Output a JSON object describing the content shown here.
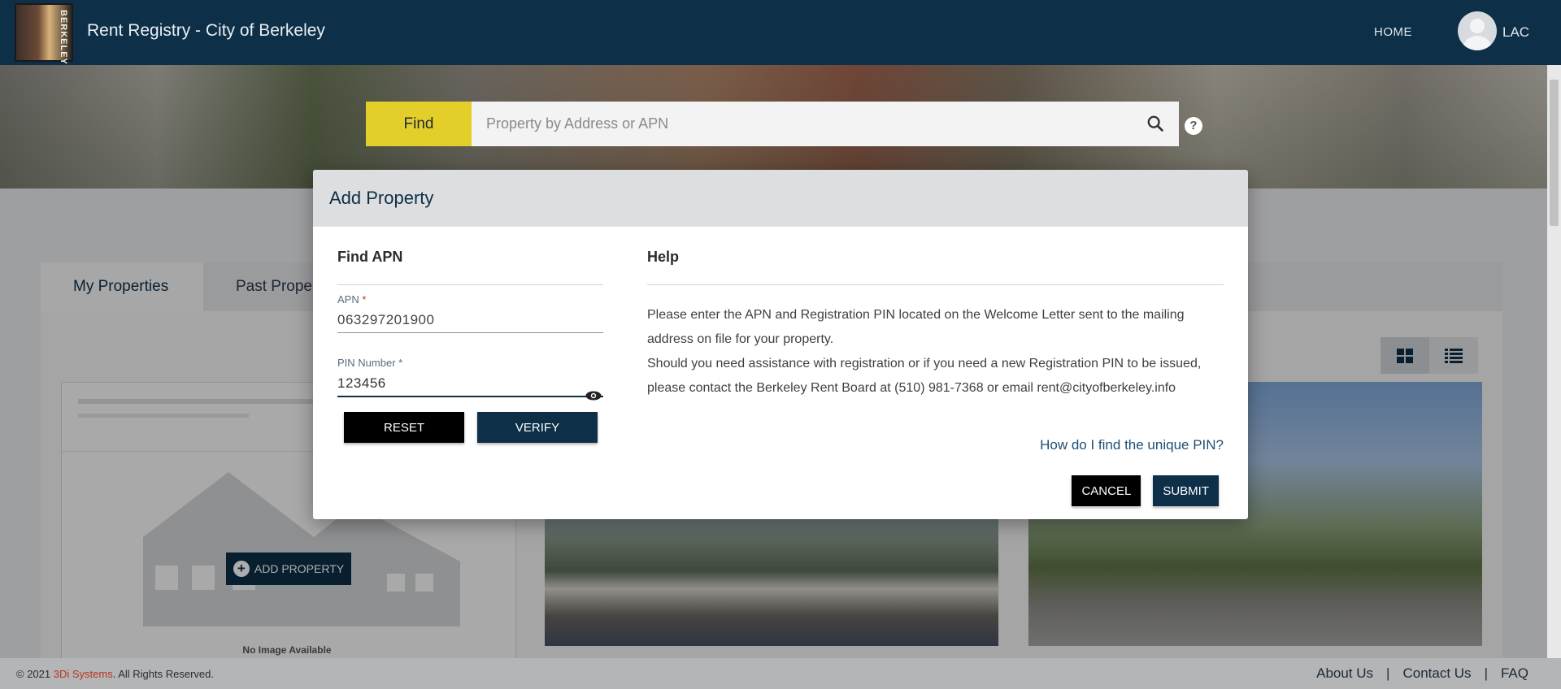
{
  "header": {
    "logo_text": "BERKELEY",
    "app_title": "Rent Registry - City of Berkeley",
    "nav_home": "HOME",
    "user_initials": "LAC"
  },
  "search": {
    "find_label": "Find",
    "placeholder": "Property by Address or APN",
    "help_glyph": "?"
  },
  "tabs": {
    "my_properties": "My Properties",
    "past_properties": "Past Proper"
  },
  "cards": {
    "add_property_label": "ADD PROPERTY",
    "no_image": "No Image Available"
  },
  "modal": {
    "title": "Add Property",
    "find_apn_title": "Find APN",
    "apn_label": "APN",
    "apn_required": "*",
    "apn_value": "063297201900",
    "pin_label": "PIN Number *",
    "pin_value": "123456",
    "reset_label": "RESET",
    "verify_label": "VERIFY",
    "help_title": "Help",
    "help_line1": "Please enter the APN and Registration PIN located on the Welcome Letter sent to the mailing address on file for your property.",
    "help_line2": "Should you need assistance with registration or if you need a new Registration PIN to be issued, please contact the Berkeley Rent Board at (510) 981-7368 or email rent@cityofberkeley.info",
    "help_link": "How do I find the unique PIN?",
    "cancel_label": "CANCEL",
    "submit_label": "SUBMIT"
  },
  "footer": {
    "copyright_prefix": "© 2021 ",
    "brand": "3Di Systems",
    "copyright_suffix": ". All Rights Reserved.",
    "links": [
      "About Us",
      "|",
      "Contact Us",
      "|",
      "FAQ"
    ]
  },
  "colors": {
    "navy": "#0d2f48",
    "find_yellow": "#e4cf2a",
    "brand_red": "#b8341f"
  },
  "icons": [
    "search-icon",
    "help-icon",
    "eye-icon",
    "grid-view-icon",
    "list-view-icon",
    "plus-icon",
    "user-avatar-icon"
  ]
}
